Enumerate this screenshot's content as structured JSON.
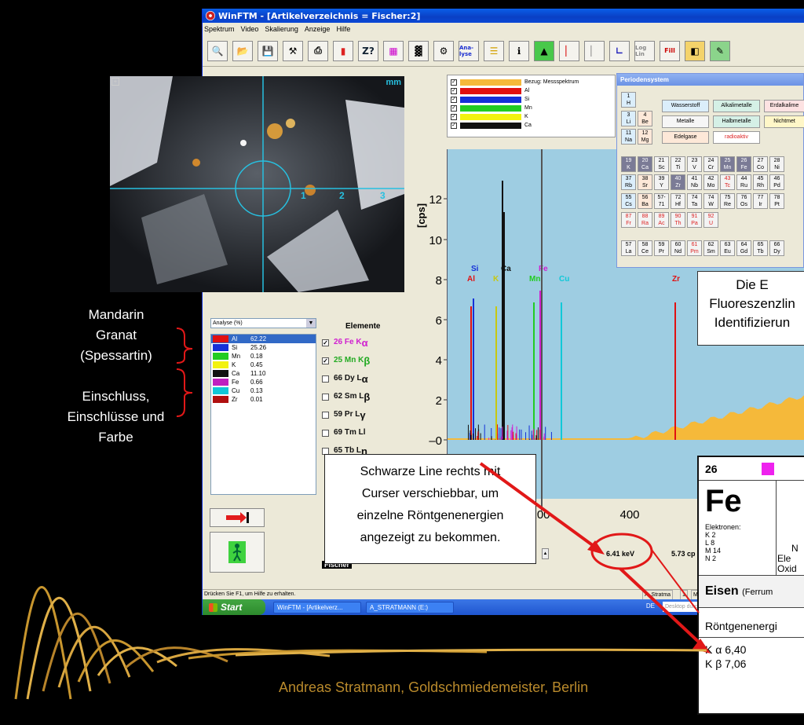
{
  "window": {
    "title": "WinFTM - [Artikelverzeichnis = Fischer:2]",
    "menu": [
      "Spektrum",
      "Video",
      "Skalierung",
      "Anzeige",
      "Hilfe"
    ]
  },
  "toolbar": {
    "z_label": "Z?",
    "analyse_label": "Ana-lyse",
    "loglin_label": "Log Lin",
    "fill_label": "Fill"
  },
  "camera": {
    "unit_label": "mm",
    "scale_marks": [
      "1",
      "2",
      "3"
    ]
  },
  "legend": [
    {
      "label": "Bezug: Messspektrum",
      "color": "#f5b93a"
    },
    {
      "label": "Al",
      "color": "#e11010"
    },
    {
      "label": "Si",
      "color": "#1530d8"
    },
    {
      "label": "Mn",
      "color": "#22cc22"
    },
    {
      "label": "K",
      "color": "#f2f210"
    },
    {
      "label": "Ca",
      "color": "#111111"
    }
  ],
  "plot": {
    "y_unit": "[cps]",
    "y_ticks": [
      "12",
      "10",
      "8",
      "6",
      "4",
      "2",
      "–0"
    ],
    "x_ticks": [
      "200",
      "400"
    ],
    "peak_labels": [
      {
        "label": "Si",
        "color": "#1530d8"
      },
      {
        "label": "Al",
        "color": "#e11010"
      },
      {
        "label": "K",
        "color": "#c8c810"
      },
      {
        "label": "Ca",
        "color": "#111111"
      },
      {
        "label": "Fe",
        "color": "#d020d0"
      },
      {
        "label": "Mn",
        "color": "#22cc22"
      },
      {
        "label": "Cu",
        "color": "#10c8d8"
      },
      {
        "label": "Zr",
        "color": "#e11010"
      }
    ]
  },
  "analysis": {
    "select_value": "Analyse (%)",
    "rows": [
      {
        "el": "Al",
        "val": "62.22",
        "color": "#e11010"
      },
      {
        "el": "Si",
        "val": "25.26",
        "color": "#1530d8"
      },
      {
        "el": "Mn",
        "val": "0.18",
        "color": "#22cc22"
      },
      {
        "el": "K",
        "val": "0.45",
        "color": "#f2f210"
      },
      {
        "el": "Ca",
        "val": "11.10",
        "color": "#111111"
      },
      {
        "el": "Fe",
        "val": "0.66",
        "color": "#c020c0"
      },
      {
        "el": "Cu",
        "val": "0.13",
        "color": "#10c8d8"
      },
      {
        "el": "Zr",
        "val": "0.01",
        "color": "#b01010"
      }
    ]
  },
  "elements": {
    "heading": "Elemente",
    "rows": [
      {
        "z": "26",
        "sym": "Fe",
        "line": "K",
        "sub": "α",
        "checked": "✓",
        "color": "#d020d0"
      },
      {
        "z": "25",
        "sym": "Mn",
        "line": "K",
        "sub": "β",
        "checked": "✓",
        "color": "#22aa22"
      },
      {
        "z": "66",
        "sym": "Dy",
        "line": "L",
        "sub": "α",
        "checked": "",
        "color": "#111111"
      },
      {
        "z": "62",
        "sym": "Sm",
        "line": "L",
        "sub": "β",
        "checked": "",
        "color": "#111111"
      },
      {
        "z": "59",
        "sym": "Pr",
        "line": "L",
        "sub": "γ",
        "checked": "",
        "color": "#111111"
      },
      {
        "z": "69",
        "sym": "Tm",
        "line": "Ll",
        "sub": "",
        "checked": "",
        "color": "#111111"
      },
      {
        "z": "65",
        "sym": "Tb",
        "line": "L",
        "sub": "η",
        "checked": "",
        "color": "#111111"
      }
    ]
  },
  "readout": {
    "energy": "6.41 keV",
    "cps": "5.73 cp"
  },
  "brand": "Fischer",
  "statusbar": {
    "hint": "Drücken Sie F1, um Hilfe zu erhalten.",
    "right1": "A. Stratma",
    "right2": "1",
    "right3": "M"
  },
  "taskbar": {
    "start": "Start",
    "task1": "WinFTM - [Artikelverz...",
    "task2": "A_STRATMANN (E:)",
    "lang": "DE",
    "search": "Desktop durchsuchen"
  },
  "pse": {
    "title": "Periodensystem",
    "categories": [
      "Wasserstoff",
      "Alkalimetalle",
      "Erdalkalime",
      "Metalle",
      "Halbmetalle",
      "Nichtmet",
      "Edelgase",
      "radioaktiv"
    ]
  },
  "info_box": {
    "l1": "Die E",
    "l2": "Fluoreszenzlin",
    "l3": "Identifizierun"
  },
  "card": {
    "z": "26",
    "symbol": "Fe",
    "electrons_label": "Elektronen:",
    "shells": [
      "K  2",
      "L  8",
      "M 14",
      "N  2"
    ],
    "side": [
      "N",
      "Ele",
      "Oxid"
    ],
    "name": "Eisen",
    "latin": "(Ferrum",
    "roentgen": "Röntgenenergi",
    "k_alpha": "K α   6,40",
    "k_beta": "K β   7,06"
  },
  "captions": {
    "granat": [
      "Mandarin",
      "Granat",
      "(Spessartin)"
    ],
    "einschluss": [
      "Einschluss,",
      "Einschlüsse und",
      "Farbe"
    ]
  },
  "note": [
    "Schwarze Line rechts mit",
    "Curser verschiebbar, um",
    "einzelne Röntgenenergien",
    "angezeigt zu bekommen."
  ],
  "footer": "Andreas Stratmann, Goldschmiedemeister, Berlin",
  "colors": {
    "annotation_red": "#e11818",
    "footer_gold": "#b98a2c",
    "plot_bg": "#9ecde2"
  }
}
